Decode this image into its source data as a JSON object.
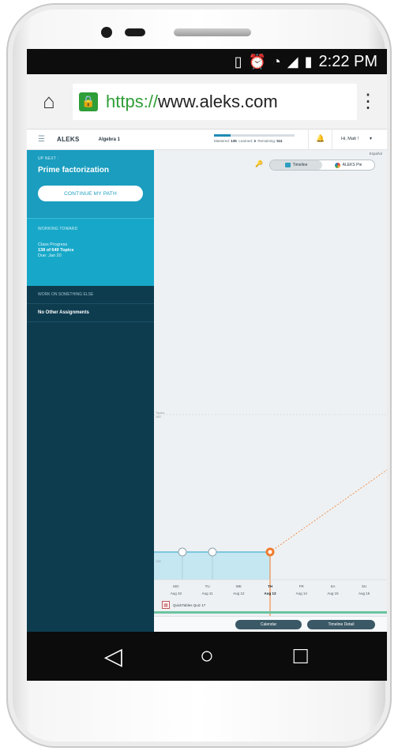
{
  "status": {
    "time": "2:22 PM"
  },
  "browser": {
    "scheme": "https://",
    "host": "www.aleks.com"
  },
  "aleks": {
    "logo": "ALEKS",
    "course": "Algebra 1",
    "progress_text_prefix": "Mastered:",
    "mastered": "135",
    "learned_label": "Learned:",
    "learned": "3",
    "remaining_label": "Remaining:",
    "remaining": "511",
    "progress_fraction": 0.21,
    "greeting": "Hi, Matt !",
    "espanol": "Español"
  },
  "sidebar": {
    "up_next_label": "UP NEXT :",
    "up_next_title": "Prime factorization",
    "continue_label": "CONTINUE MY PATH",
    "working_toward_label": "WORKING TOWARD",
    "class_progress": "Class Progress",
    "topics": "138 of 649 Topics",
    "due": "Due: Jan 20",
    "work_on_else_label": "WORK ON SOMETHING ELSE",
    "no_assignments": "No Other Assignments"
  },
  "view_toggle": {
    "timeline": "Timeline",
    "pie": "ALEKS Pie"
  },
  "chart": {
    "topics_label": "Topics",
    "upper_value": "160",
    "lower_value": "130"
  },
  "days": [
    {
      "dow": "MO",
      "date": "Aug 10"
    },
    {
      "dow": "TU",
      "date": "Aug 11"
    },
    {
      "dow": "WE",
      "date": "Aug 12"
    },
    {
      "dow": "TH",
      "date": "Aug 13"
    },
    {
      "dow": "FR",
      "date": "Aug 14"
    },
    {
      "dow": "SA",
      "date": "Aug 15"
    },
    {
      "dow": "SU",
      "date": "Aug 16"
    }
  ],
  "quiz": {
    "label": "QuickTables Quiz 17"
  },
  "buttons": {
    "calendar": "Calendar",
    "timeline_detail": "Timeline Detail"
  },
  "colors": {
    "teal": "#1a9dbf",
    "navy": "#0e3c4f",
    "today": "#f07b2e",
    "area": "#bfe6f0"
  }
}
